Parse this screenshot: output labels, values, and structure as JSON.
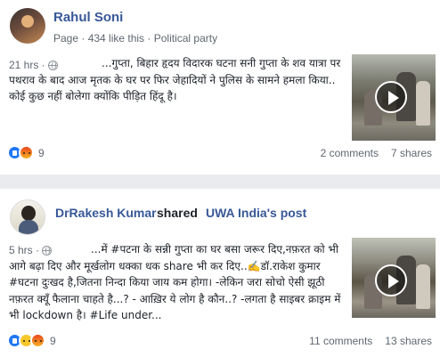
{
  "posts": [
    {
      "author": "Rahul Soni",
      "subtitle": "Page · 434 like this · Political party",
      "time": "21 hrs · ",
      "text": "...गुप्ता, बिहार हृदय विदारक घटना सनी गुप्ता के शव यात्रा पर पथराव के बाद आज मृतक के घर पर फिर जेहादियों ने पुलिस के सामने हमला किया.. कोई कुछ नहीं बोलेगा क्योंकि पीड़ित हिंदू है।",
      "reaction_count": "9",
      "comments": "2 comments",
      "shares": "7 shares"
    },
    {
      "author": "DrRakesh Kumar",
      "shared_word": "shared",
      "shared_page": "UWA India's post",
      "time": "5 hrs · ",
      "text": "...में #पटना के सन्नी गुप्ता का घर बसा जरूर दिए,नफ़रत को भी आगे बढ़ा दिए और मूर्खलोग धक्का धक share भी कर दिए..✍️डॉ.राकेश कुमार #घटना दुःखद है,जितना निन्दा किया जाय कम होगा। -लेकिन जरा सोचो ऐसी झूठी नफ़रत क्यूँ फैलाना चाहते है...? - आख़िर ये लोग है कौन..? -लगता है साइबर क्राइम में भी lockdown है। #Life under...",
      "reaction_count": "9",
      "comments": "11 comments",
      "shares": "13 shares"
    }
  ],
  "icons": [
    "globe-icon",
    "play-icon",
    "like-reaction-icon",
    "angry-reaction-icon",
    "sad-reaction-icon"
  ],
  "colors": {
    "link": "#385898",
    "meta": "#606770",
    "like": "#2078f4",
    "background": "#e9ebee"
  }
}
